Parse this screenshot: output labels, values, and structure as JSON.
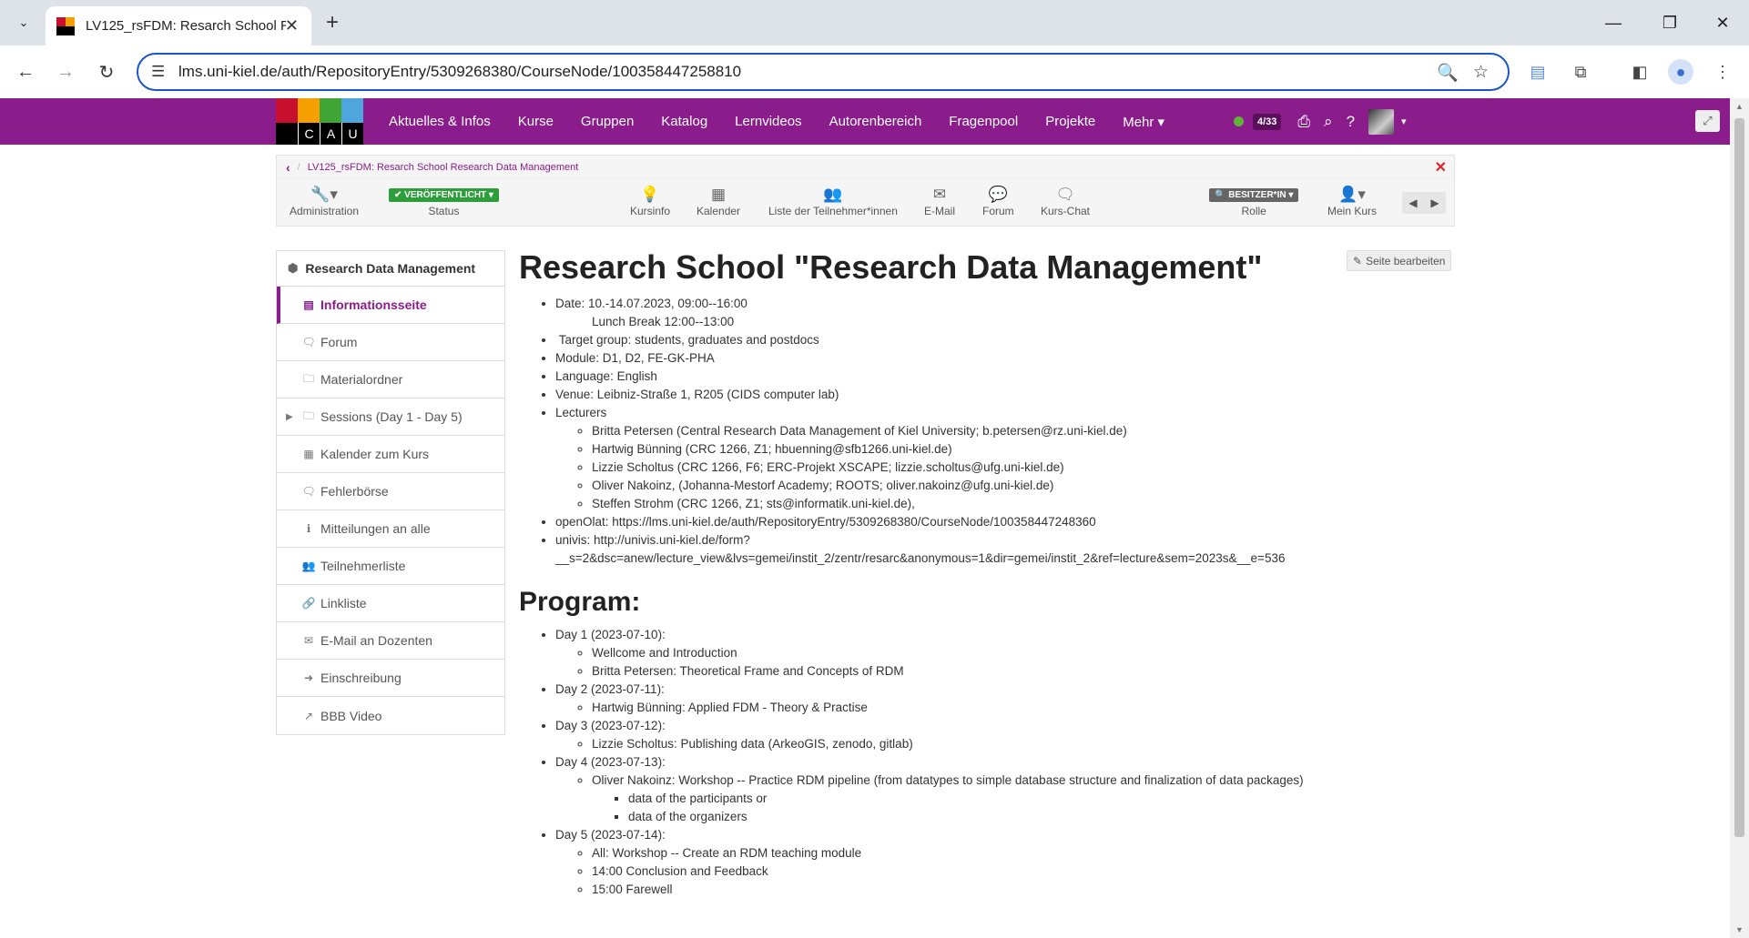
{
  "browser": {
    "tab_title": "LV125_rsFDM: Resarch School R",
    "url": "lms.uni-kiel.de/auth/RepositoryEntry/5309268380/CourseNode/100358447258810"
  },
  "site_nav": {
    "logo_letters": [
      "C",
      "A",
      "U"
    ],
    "menu": [
      "Aktuelles & Infos",
      "Kurse",
      "Gruppen",
      "Katalog",
      "Lernvideos",
      "Autorenbereich",
      "Fragenpool",
      "Projekte",
      "Mehr ▾"
    ],
    "user_count": "4/33"
  },
  "breadcrumb": {
    "back": "‹",
    "course": "LV125_rsFDM: Resarch School Research Data Management"
  },
  "course_toolbar": {
    "administration": "Administration",
    "status_badge": "✔ VERÖFFENTLICHT ▾",
    "status_label": "Status",
    "kursinfo": "Kursinfo",
    "kalender": "Kalender",
    "teilnehmer": "Liste der Teilnehmer*innen",
    "email": "E-Mail",
    "forum": "Forum",
    "kurs_chat": "Kurs-Chat",
    "role_badge": "🔍 BESITZER*IN ▾",
    "role_label": "Rolle",
    "mein_kurs": "Mein Kurs"
  },
  "sidebar": {
    "title": "Research Data Management",
    "items": [
      {
        "label": "Informationsseite",
        "icon": "page-icon"
      },
      {
        "label": "Forum",
        "icon": "comment-icon"
      },
      {
        "label": "Materialordner",
        "icon": "folder-icon"
      },
      {
        "label": "Sessions (Day 1 - Day 5)",
        "icon": "folder-icon"
      },
      {
        "label": "Kalender zum Kurs",
        "icon": "calendar-icon"
      },
      {
        "label": "Fehlerbörse",
        "icon": "comment-icon"
      },
      {
        "label": "Mitteilungen an alle",
        "icon": "info-icon"
      },
      {
        "label": "Teilnehmerliste",
        "icon": "users-icon"
      },
      {
        "label": "Linkliste",
        "icon": "link-icon"
      },
      {
        "label": "E-Mail an Dozenten",
        "icon": "mail-icon"
      },
      {
        "label": "Einschreibung",
        "icon": "signin-icon"
      },
      {
        "label": "BBB Video",
        "icon": "external-link-icon"
      }
    ]
  },
  "content": {
    "edit_button": "Seite bearbeiten",
    "title": "Research School \"Research Data Management\"",
    "info": {
      "date": "Date: 10.-14.07.2023, 09:00--16:00",
      "lunch": "Lunch Break 12:00--13:00",
      "target": "Target group: students, graduates and postdocs",
      "module": "Module: D1, D2, FE-GK-PHA",
      "language": "Language: English",
      "venue": "Venue: Leibniz-Straße 1, R205 (CIDS computer lab)",
      "lecturers": "Lecturers",
      "lecturer_list": [
        "Britta Petersen (Central Research Data Management of Kiel University; b.petersen@rz.uni-kiel.de)",
        "Hartwig Bünning (CRC 1266, Z1; hbuenning@sfb1266.uni-kiel.de)",
        "Lizzie Scholtus (CRC 1266, F6; ERC-Projekt XSCAPE; lizzie.scholtus@ufg.uni-kiel.de)",
        "Oliver Nakoinz, (Johanna-Mestorf Academy; ROOTS; oliver.nakoinz@ufg.uni-kiel.de)",
        "Steffen Strohm  (CRC 1266, Z1; sts@informatik.uni-kiel.de),"
      ],
      "openolat": "openOlat: https://lms.uni-kiel.de/auth/RepositoryEntry/5309268380/CourseNode/100358447248360",
      "univis_1": "univis: http://univis.uni-kiel.de/form?",
      "univis_2": "__s=2&dsc=anew/lecture_view&lvs=gemei/instit_2/zentr/resarc&anonymous=1&dir=gemei/instit_2&ref=lecture&sem=2023s&__e=536"
    },
    "program_title": "Program:",
    "program": {
      "day1": "Day 1 (2023-07-10):",
      "day1_items": [
        "Wellcome and Introduction",
        "Britta Petersen: Theoretical Frame and Concepts of RDM"
      ],
      "day2": "Day 2 (2023-07-11):",
      "day2_items": [
        "Hartwig Bünning: Applied FDM - Theory & Practise"
      ],
      "day3": "Day 3 (2023-07-12):",
      "day3_items": [
        "Lizzie Scholtus: Publishing data (ArkeoGIS, zenodo, gitlab)"
      ],
      "day4": "Day 4 (2023-07-13):",
      "day4_item": "Oliver Nakoinz: Workshop -- Practice RDM pipeline (from datatypes to simple database structure and finalization of data packages)",
      "day4_sub": [
        "data of the participants or",
        "data of the organizers"
      ],
      "day5": "Day 5 (2023-07-14):",
      "day5_items": [
        "All: Workshop -- Create an RDM teaching module",
        "14:00 Conclusion and Feedback",
        "15:00 Farewell"
      ]
    }
  },
  "colors": {
    "brand": "#8b1c8c",
    "status_green": "#2e9e3a"
  }
}
